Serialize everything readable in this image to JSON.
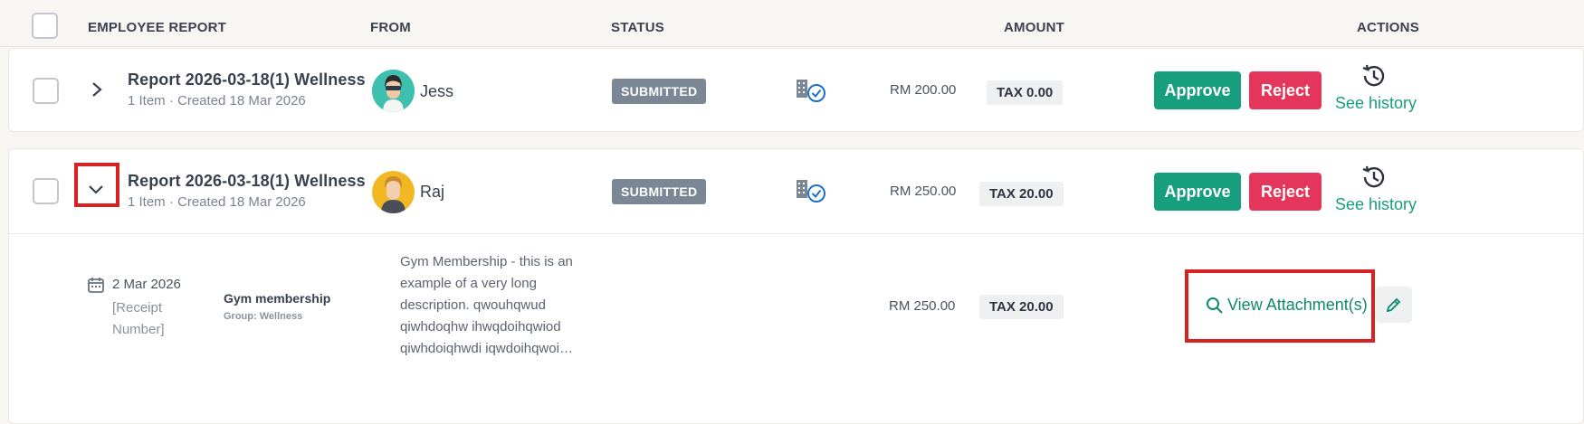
{
  "header": {
    "col_report": "EMPLOYEE REPORT",
    "col_from": "FROM",
    "col_status": "STATUS",
    "col_amount": "AMOUNT",
    "col_actions": "ACTIONS"
  },
  "rows": [
    {
      "title": "Report 2026-03-18(1) Wellness",
      "subtitle": "1 Item · Created 18 Mar 2026",
      "from": "Jess",
      "status": "SUBMITTED",
      "amount": "RM 200.00",
      "tax": "TAX 0.00",
      "approve": "Approve",
      "reject": "Reject",
      "history": "See history",
      "expanded": false
    },
    {
      "title": "Report 2026-03-18(1) Wellness",
      "subtitle": "1 Item · Created 18 Mar 2026",
      "from": "Raj",
      "status": "SUBMITTED",
      "amount": "RM 250.00",
      "tax": "TAX 20.00",
      "approve": "Approve",
      "reject": "Reject",
      "history": "See history",
      "expanded": true
    }
  ],
  "detail": {
    "date": "2 Mar 2026",
    "receipt_line1": "[Receipt",
    "receipt_line2": "Number]",
    "category": "Gym membership",
    "group": "Group: Wellness",
    "desc_lines": [
      "Gym Membership - this is an",
      "example of a very long",
      "description. qwouhqwud",
      "qiwhdoqhw ihwqdoihqwiod",
      "qiwhdoiqhwdi iqwdoihqwoi…"
    ],
    "amount": "RM 250.00",
    "tax": "TAX 20.00",
    "view_attachments": "View Attachment(s)"
  },
  "colors": {
    "approve": "#169e7d",
    "reject": "#e3365a",
    "status": "#7b8794",
    "link": "#0f8a6f",
    "highlight": "#d82222"
  },
  "icons": [
    "checkbox",
    "chevron-right-icon",
    "chevron-down-icon",
    "building-check-icon",
    "history-icon",
    "calendar-icon",
    "search-icon",
    "pencil-icon"
  ]
}
